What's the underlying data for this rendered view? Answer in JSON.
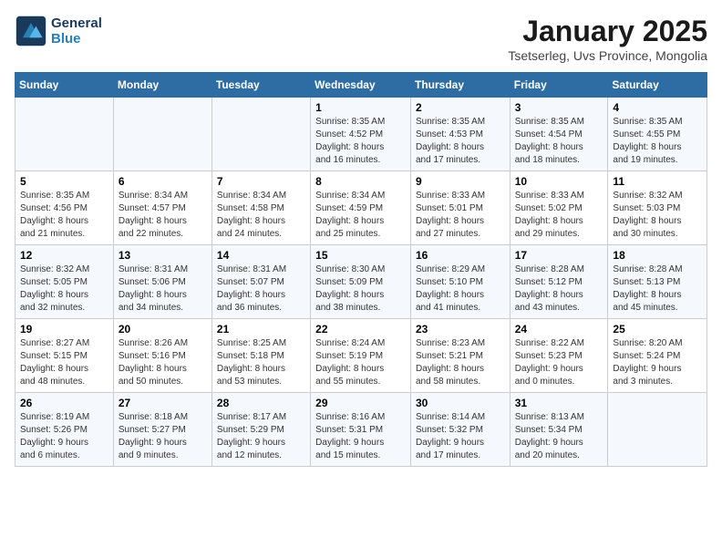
{
  "header": {
    "logo_line1": "General",
    "logo_line2": "Blue",
    "title": "January 2025",
    "subtitle": "Tsetserleg, Uvs Province, Mongolia"
  },
  "days_of_week": [
    "Sunday",
    "Monday",
    "Tuesday",
    "Wednesday",
    "Thursday",
    "Friday",
    "Saturday"
  ],
  "weeks": [
    [
      {
        "num": "",
        "detail": ""
      },
      {
        "num": "",
        "detail": ""
      },
      {
        "num": "",
        "detail": ""
      },
      {
        "num": "1",
        "detail": "Sunrise: 8:35 AM\nSunset: 4:52 PM\nDaylight: 8 hours\nand 16 minutes."
      },
      {
        "num": "2",
        "detail": "Sunrise: 8:35 AM\nSunset: 4:53 PM\nDaylight: 8 hours\nand 17 minutes."
      },
      {
        "num": "3",
        "detail": "Sunrise: 8:35 AM\nSunset: 4:54 PM\nDaylight: 8 hours\nand 18 minutes."
      },
      {
        "num": "4",
        "detail": "Sunrise: 8:35 AM\nSunset: 4:55 PM\nDaylight: 8 hours\nand 19 minutes."
      }
    ],
    [
      {
        "num": "5",
        "detail": "Sunrise: 8:35 AM\nSunset: 4:56 PM\nDaylight: 8 hours\nand 21 minutes."
      },
      {
        "num": "6",
        "detail": "Sunrise: 8:34 AM\nSunset: 4:57 PM\nDaylight: 8 hours\nand 22 minutes."
      },
      {
        "num": "7",
        "detail": "Sunrise: 8:34 AM\nSunset: 4:58 PM\nDaylight: 8 hours\nand 24 minutes."
      },
      {
        "num": "8",
        "detail": "Sunrise: 8:34 AM\nSunset: 4:59 PM\nDaylight: 8 hours\nand 25 minutes."
      },
      {
        "num": "9",
        "detail": "Sunrise: 8:33 AM\nSunset: 5:01 PM\nDaylight: 8 hours\nand 27 minutes."
      },
      {
        "num": "10",
        "detail": "Sunrise: 8:33 AM\nSunset: 5:02 PM\nDaylight: 8 hours\nand 29 minutes."
      },
      {
        "num": "11",
        "detail": "Sunrise: 8:32 AM\nSunset: 5:03 PM\nDaylight: 8 hours\nand 30 minutes."
      }
    ],
    [
      {
        "num": "12",
        "detail": "Sunrise: 8:32 AM\nSunset: 5:05 PM\nDaylight: 8 hours\nand 32 minutes."
      },
      {
        "num": "13",
        "detail": "Sunrise: 8:31 AM\nSunset: 5:06 PM\nDaylight: 8 hours\nand 34 minutes."
      },
      {
        "num": "14",
        "detail": "Sunrise: 8:31 AM\nSunset: 5:07 PM\nDaylight: 8 hours\nand 36 minutes."
      },
      {
        "num": "15",
        "detail": "Sunrise: 8:30 AM\nSunset: 5:09 PM\nDaylight: 8 hours\nand 38 minutes."
      },
      {
        "num": "16",
        "detail": "Sunrise: 8:29 AM\nSunset: 5:10 PM\nDaylight: 8 hours\nand 41 minutes."
      },
      {
        "num": "17",
        "detail": "Sunrise: 8:28 AM\nSunset: 5:12 PM\nDaylight: 8 hours\nand 43 minutes."
      },
      {
        "num": "18",
        "detail": "Sunrise: 8:28 AM\nSunset: 5:13 PM\nDaylight: 8 hours\nand 45 minutes."
      }
    ],
    [
      {
        "num": "19",
        "detail": "Sunrise: 8:27 AM\nSunset: 5:15 PM\nDaylight: 8 hours\nand 48 minutes."
      },
      {
        "num": "20",
        "detail": "Sunrise: 8:26 AM\nSunset: 5:16 PM\nDaylight: 8 hours\nand 50 minutes."
      },
      {
        "num": "21",
        "detail": "Sunrise: 8:25 AM\nSunset: 5:18 PM\nDaylight: 8 hours\nand 53 minutes."
      },
      {
        "num": "22",
        "detail": "Sunrise: 8:24 AM\nSunset: 5:19 PM\nDaylight: 8 hours\nand 55 minutes."
      },
      {
        "num": "23",
        "detail": "Sunrise: 8:23 AM\nSunset: 5:21 PM\nDaylight: 8 hours\nand 58 minutes."
      },
      {
        "num": "24",
        "detail": "Sunrise: 8:22 AM\nSunset: 5:23 PM\nDaylight: 9 hours\nand 0 minutes."
      },
      {
        "num": "25",
        "detail": "Sunrise: 8:20 AM\nSunset: 5:24 PM\nDaylight: 9 hours\nand 3 minutes."
      }
    ],
    [
      {
        "num": "26",
        "detail": "Sunrise: 8:19 AM\nSunset: 5:26 PM\nDaylight: 9 hours\nand 6 minutes."
      },
      {
        "num": "27",
        "detail": "Sunrise: 8:18 AM\nSunset: 5:27 PM\nDaylight: 9 hours\nand 9 minutes."
      },
      {
        "num": "28",
        "detail": "Sunrise: 8:17 AM\nSunset: 5:29 PM\nDaylight: 9 hours\nand 12 minutes."
      },
      {
        "num": "29",
        "detail": "Sunrise: 8:16 AM\nSunset: 5:31 PM\nDaylight: 9 hours\nand 15 minutes."
      },
      {
        "num": "30",
        "detail": "Sunrise: 8:14 AM\nSunset: 5:32 PM\nDaylight: 9 hours\nand 17 minutes."
      },
      {
        "num": "31",
        "detail": "Sunrise: 8:13 AM\nSunset: 5:34 PM\nDaylight: 9 hours\nand 20 minutes."
      },
      {
        "num": "",
        "detail": ""
      }
    ]
  ]
}
